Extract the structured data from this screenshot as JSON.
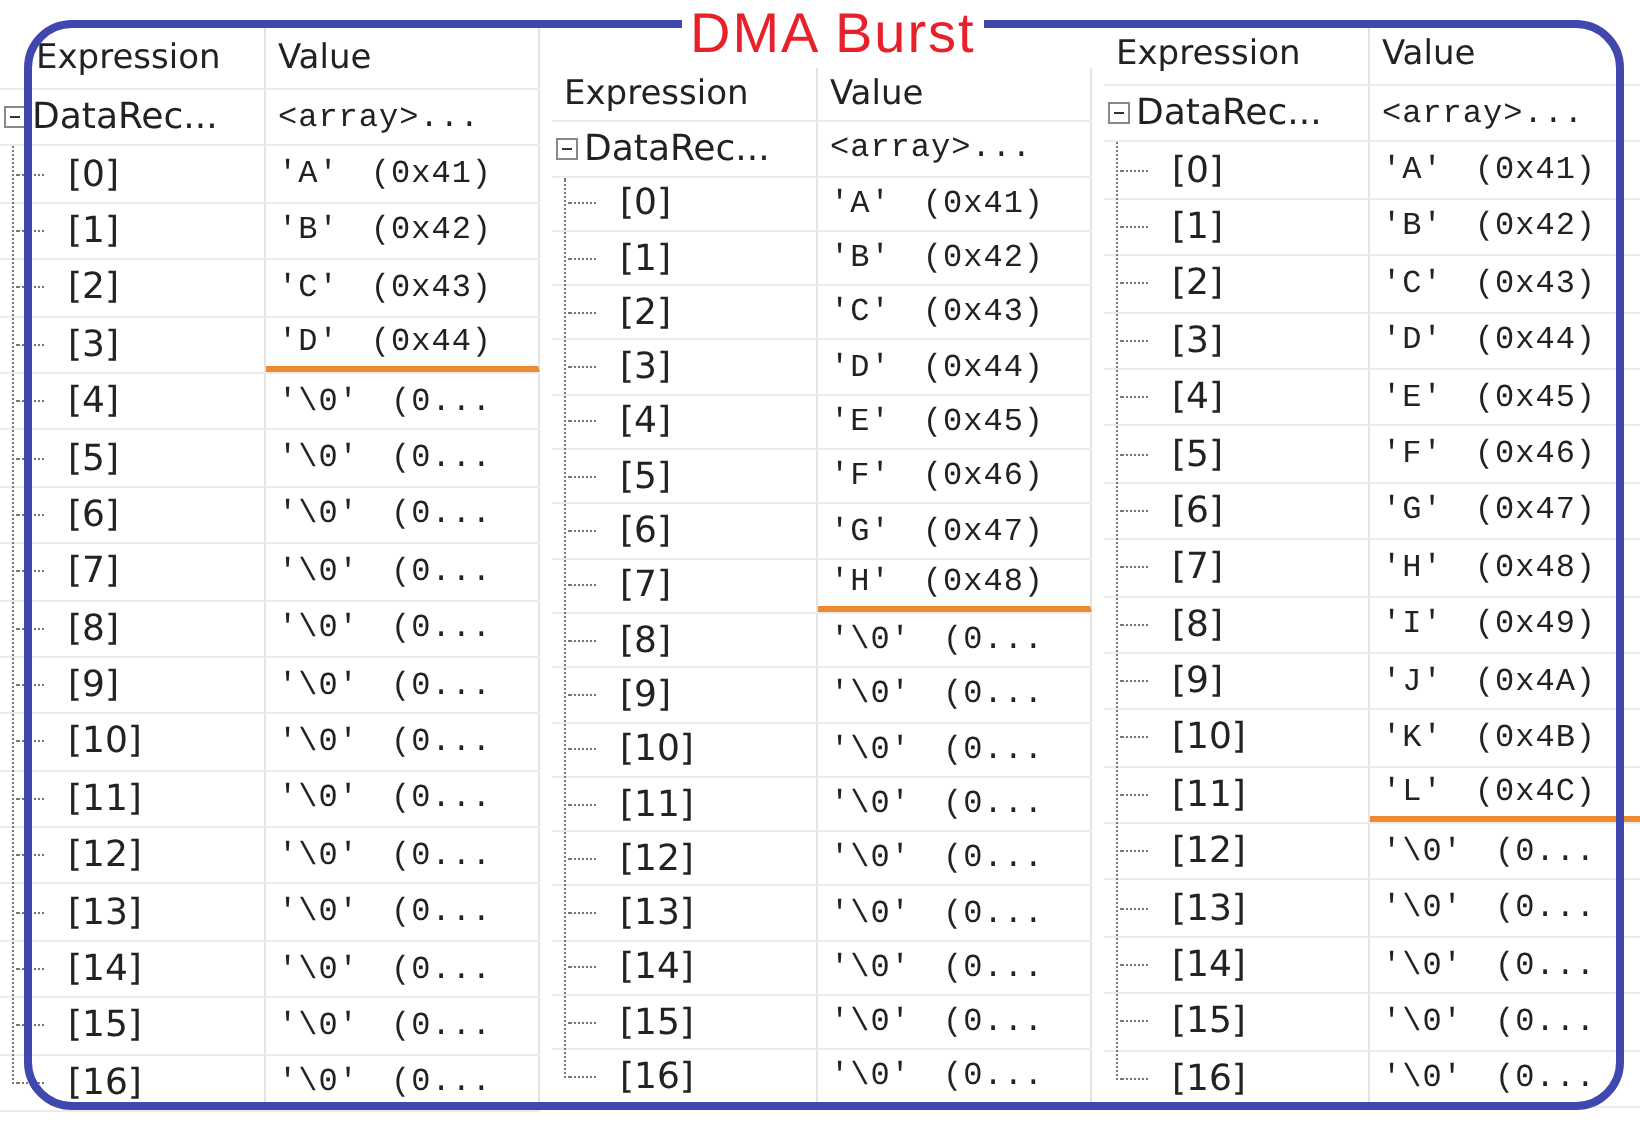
{
  "title": "DMA Burst",
  "panels": [
    {
      "columns": [
        "Expression",
        "Value"
      ],
      "root": {
        "name": "DataRec...",
        "value": "<array>...",
        "expanded": true,
        "children": [
          {
            "name": "[0]",
            "value": "'A' (0x41)",
            "marked": false
          },
          {
            "name": "[1]",
            "value": "'B' (0x42)",
            "marked": false
          },
          {
            "name": "[2]",
            "value": "'C' (0x43)",
            "marked": false
          },
          {
            "name": "[3]",
            "value": "'D' (0x44)",
            "marked": true
          },
          {
            "name": "[4]",
            "value": "'\\0' (0...",
            "marked": false
          },
          {
            "name": "[5]",
            "value": "'\\0' (0...",
            "marked": false
          },
          {
            "name": "[6]",
            "value": "'\\0' (0...",
            "marked": false
          },
          {
            "name": "[7]",
            "value": "'\\0' (0...",
            "marked": false
          },
          {
            "name": "[8]",
            "value": "'\\0' (0...",
            "marked": false
          },
          {
            "name": "[9]",
            "value": "'\\0' (0...",
            "marked": false
          },
          {
            "name": "[10]",
            "value": "'\\0' (0...",
            "marked": false
          },
          {
            "name": "[11]",
            "value": "'\\0' (0...",
            "marked": false
          },
          {
            "name": "[12]",
            "value": "'\\0' (0...",
            "marked": false
          },
          {
            "name": "[13]",
            "value": "'\\0' (0...",
            "marked": false
          },
          {
            "name": "[14]",
            "value": "'\\0' (0...",
            "marked": false
          },
          {
            "name": "[15]",
            "value": "'\\0' (0...",
            "marked": false
          },
          {
            "name": "[16]",
            "value": "'\\0' (0...",
            "marked": false
          }
        ]
      }
    },
    {
      "columns": [
        "Expression",
        "Value"
      ],
      "root": {
        "name": "DataRec...",
        "value": "<array>...",
        "expanded": true,
        "children": [
          {
            "name": "[0]",
            "value": "'A' (0x41)",
            "marked": false
          },
          {
            "name": "[1]",
            "value": "'B' (0x42)",
            "marked": false
          },
          {
            "name": "[2]",
            "value": "'C' (0x43)",
            "marked": false
          },
          {
            "name": "[3]",
            "value": "'D' (0x44)",
            "marked": false
          },
          {
            "name": "[4]",
            "value": "'E' (0x45)",
            "marked": false
          },
          {
            "name": "[5]",
            "value": "'F' (0x46)",
            "marked": false
          },
          {
            "name": "[6]",
            "value": "'G' (0x47)",
            "marked": false
          },
          {
            "name": "[7]",
            "value": "'H' (0x48)",
            "marked": true
          },
          {
            "name": "[8]",
            "value": "'\\0' (0...",
            "marked": false
          },
          {
            "name": "[9]",
            "value": "'\\0' (0...",
            "marked": false
          },
          {
            "name": "[10]",
            "value": "'\\0' (0...",
            "marked": false
          },
          {
            "name": "[11]",
            "value": "'\\0' (0...",
            "marked": false
          },
          {
            "name": "[12]",
            "value": "'\\0' (0...",
            "marked": false
          },
          {
            "name": "[13]",
            "value": "'\\0' (0...",
            "marked": false
          },
          {
            "name": "[14]",
            "value": "'\\0' (0...",
            "marked": false
          },
          {
            "name": "[15]",
            "value": "'\\0' (0...",
            "marked": false
          },
          {
            "name": "[16]",
            "value": "'\\0' (0...",
            "marked": false
          }
        ]
      }
    },
    {
      "columns": [
        "Expression",
        "Value"
      ],
      "root": {
        "name": "DataRec...",
        "value": "<array>...",
        "expanded": true,
        "children": [
          {
            "name": "[0]",
            "value": "'A' (0x41)",
            "marked": false
          },
          {
            "name": "[1]",
            "value": "'B' (0x42)",
            "marked": false
          },
          {
            "name": "[2]",
            "value": "'C' (0x43)",
            "marked": false
          },
          {
            "name": "[3]",
            "value": "'D' (0x44)",
            "marked": false
          },
          {
            "name": "[4]",
            "value": "'E' (0x45)",
            "marked": false
          },
          {
            "name": "[5]",
            "value": "'F' (0x46)",
            "marked": false
          },
          {
            "name": "[6]",
            "value": "'G' (0x47)",
            "marked": false
          },
          {
            "name": "[7]",
            "value": "'H' (0x48)",
            "marked": false
          },
          {
            "name": "[8]",
            "value": "'I' (0x49)",
            "marked": false
          },
          {
            "name": "[9]",
            "value": "'J' (0x4A)",
            "marked": false
          },
          {
            "name": "[10]",
            "value": "'K' (0x4B)",
            "marked": false
          },
          {
            "name": "[11]",
            "value": "'L' (0x4C)",
            "marked": true
          },
          {
            "name": "[12]",
            "value": "'\\0' (0...",
            "marked": false
          },
          {
            "name": "[13]",
            "value": "'\\0' (0...",
            "marked": false
          },
          {
            "name": "[14]",
            "value": "'\\0' (0...",
            "marked": false
          },
          {
            "name": "[15]",
            "value": "'\\0' (0...",
            "marked": false
          },
          {
            "name": "[16]",
            "value": "'\\0' (0...",
            "marked": false
          }
        ]
      }
    }
  ]
}
